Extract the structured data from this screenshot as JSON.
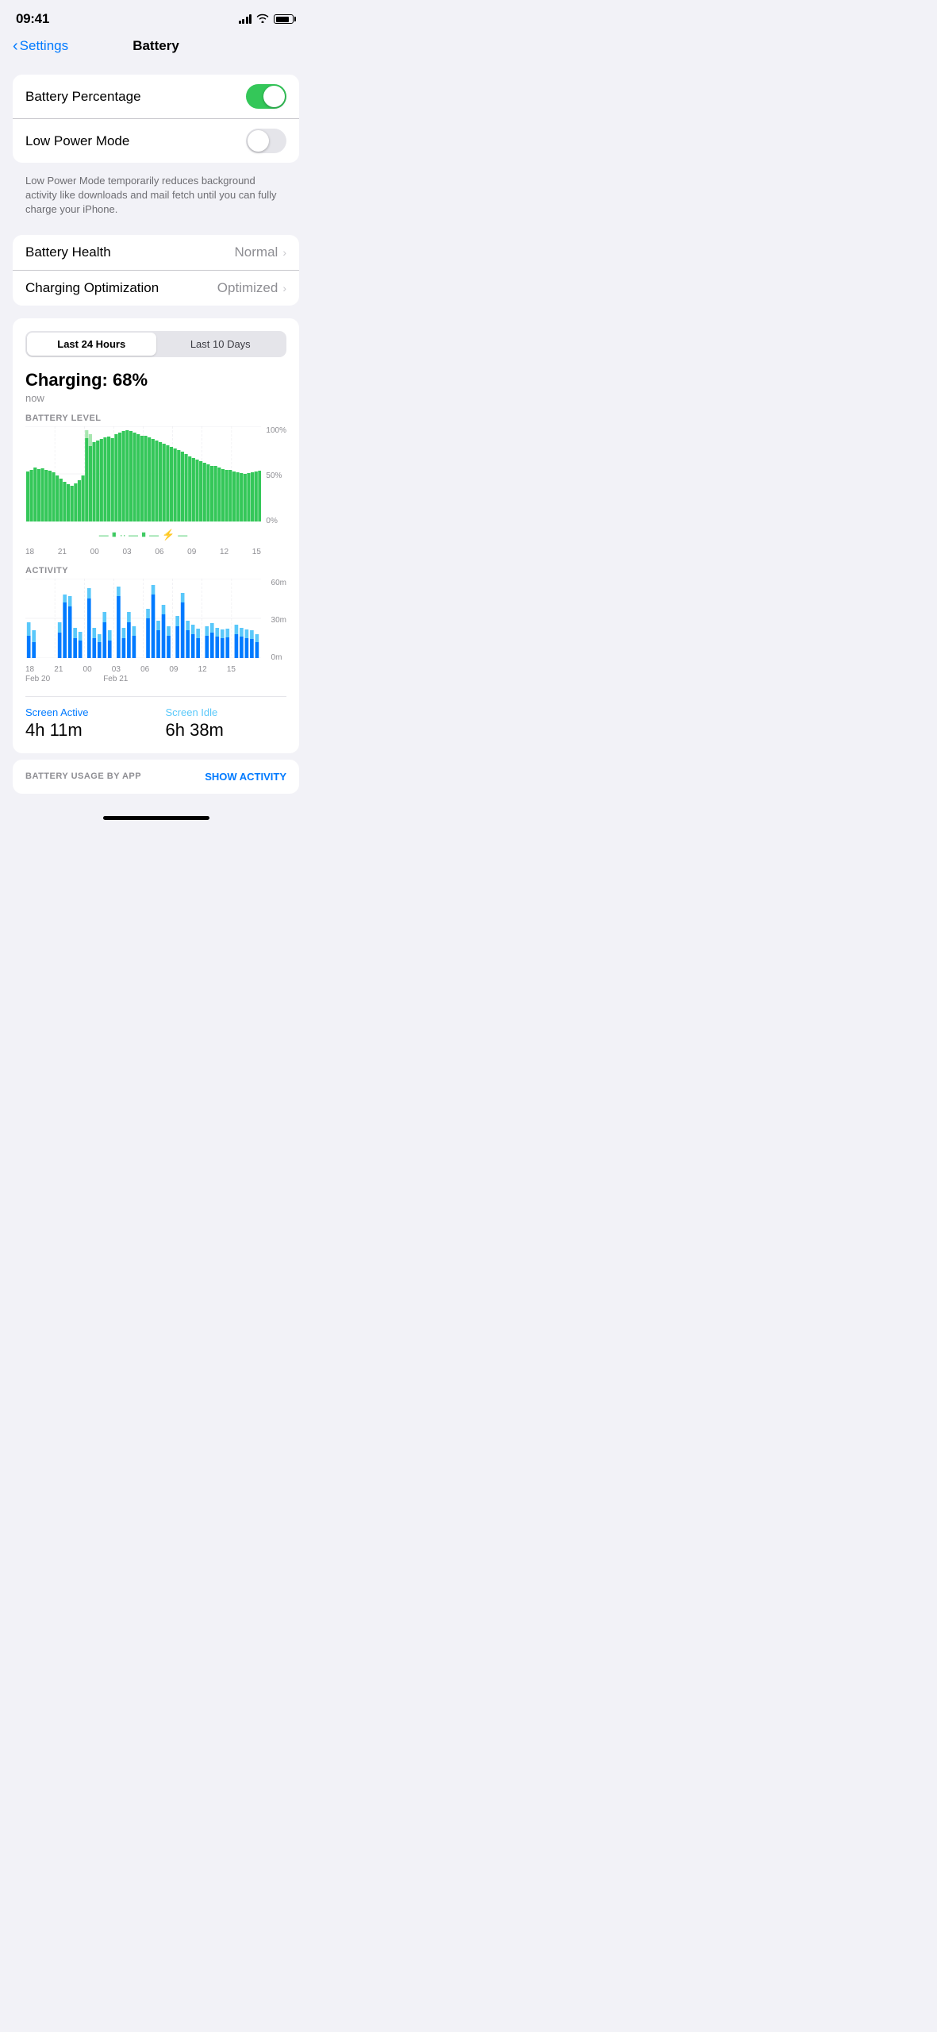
{
  "statusBar": {
    "time": "09:41"
  },
  "navBar": {
    "backLabel": "Settings",
    "title": "Battery"
  },
  "settings": {
    "card1": {
      "row1": {
        "label": "Battery Percentage",
        "toggleOn": true
      },
      "row2": {
        "label": "Low Power Mode",
        "toggleOn": false
      },
      "description": "Low Power Mode temporarily reduces background activity like downloads and mail fetch until you can fully charge your iPhone."
    },
    "card2": {
      "row1": {
        "label": "Battery Health",
        "value": "Normal"
      },
      "row2": {
        "label": "Charging Optimization",
        "value": "Optimized"
      }
    }
  },
  "chartCard": {
    "tabs": {
      "tab1": "Last 24 Hours",
      "tab2": "Last 10 Days",
      "activeTab": 0
    },
    "charging": {
      "title": "Charging: 68%",
      "subtitle": "now"
    },
    "batteryChart": {
      "sectionLabel": "BATTERY LEVEL",
      "yLabels": [
        "100%",
        "50%",
        "0%"
      ],
      "xLabels": [
        "18",
        "21",
        "00",
        "03",
        "06",
        "09",
        "12",
        "15"
      ]
    },
    "activityChart": {
      "sectionLabel": "ACTIVITY",
      "yLabels": [
        "60m",
        "30m",
        "0m"
      ],
      "xLabels": [
        "18",
        "21",
        "00",
        "03",
        "06",
        "09",
        "12",
        "15"
      ],
      "dateLabels": [
        "Feb 20",
        "",
        "Feb 21",
        "",
        "",
        "",
        "",
        ""
      ]
    },
    "screenStats": {
      "active": {
        "label": "Screen Active",
        "value": "4h 11m"
      },
      "idle": {
        "label": "Screen Idle",
        "value": "6h 38m"
      }
    }
  },
  "bottomBar": {
    "label": "BATTERY USAGE BY APP",
    "action": "SHOW ACTIVITY"
  }
}
